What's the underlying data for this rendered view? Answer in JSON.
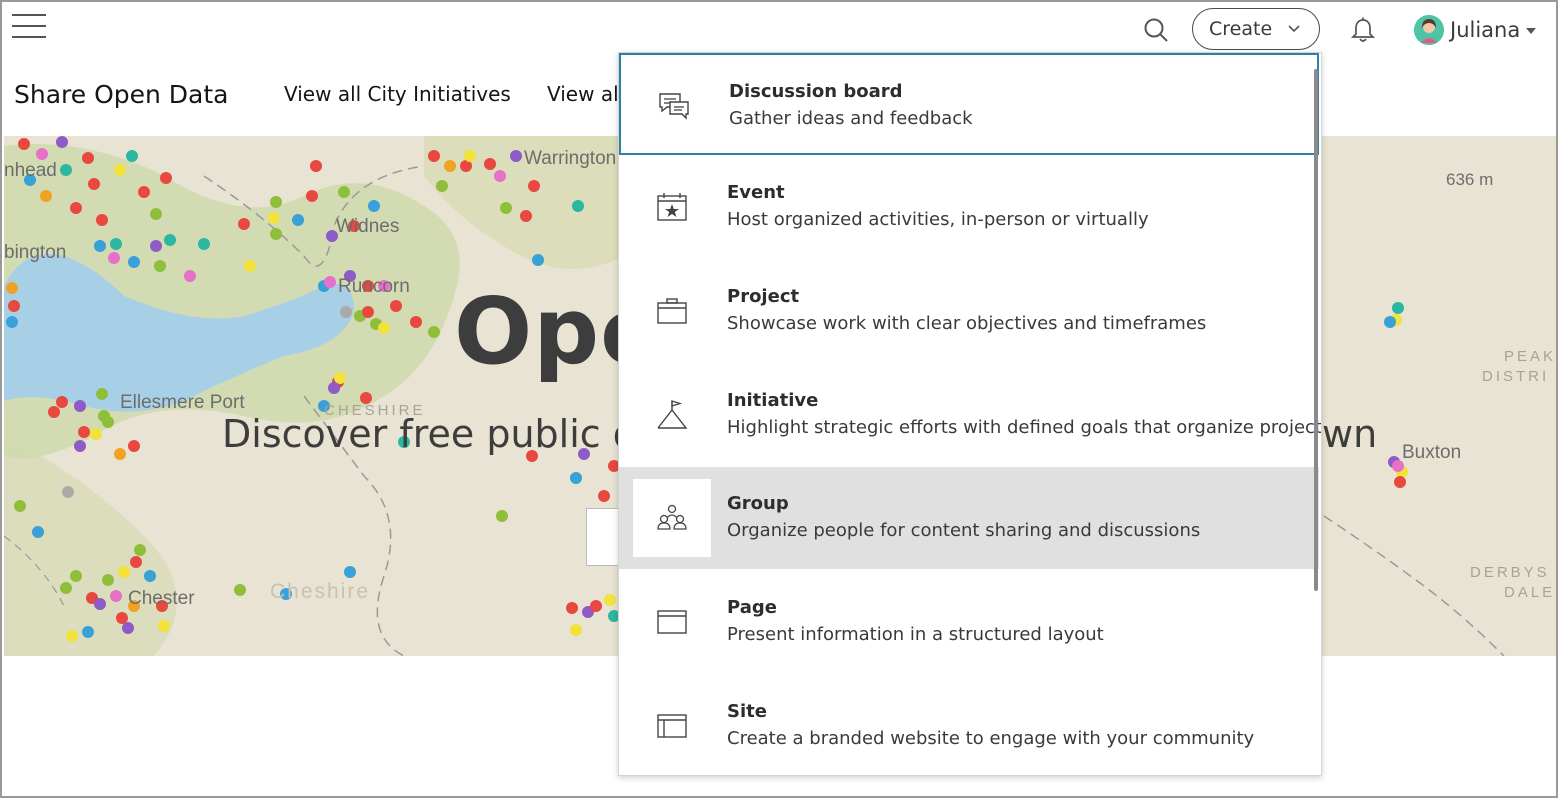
{
  "header": {
    "create_label": "Create",
    "user_name": "Juliana"
  },
  "nav": {
    "site_title": "Share Open Data",
    "links": [
      "View all City Initiatives",
      "View all"
    ]
  },
  "hero": {
    "title": "Ope",
    "subtitle": "Discover free public d",
    "subtitle_end": "wn",
    "map_labels": [
      "nhead",
      "Warrington",
      "bington",
      "Widnes",
      "Runcorn",
      "Ellesmere Port",
      "CHESHIRE",
      "Chester",
      "Cheshire",
      "636 m",
      "PEAK",
      "DISTRI",
      "Buxton",
      "DERBYS",
      "DALE"
    ]
  },
  "create_menu": {
    "items": [
      {
        "label": "Discussion board",
        "description": "Gather ideas and feedback",
        "icon": "discussion-icon"
      },
      {
        "label": "Event",
        "description": "Host organized activities, in-person or virtually",
        "icon": "event-calendar-icon"
      },
      {
        "label": "Project",
        "description": "Showcase work with clear objectives and timeframes",
        "icon": "briefcase-icon"
      },
      {
        "label": "Initiative",
        "description": "Highlight strategic efforts with defined goals that organize projects",
        "icon": "flag-mountain-icon"
      },
      {
        "label": "Group",
        "description": "Organize people for content sharing and discussions",
        "icon": "group-people-icon"
      },
      {
        "label": "Page",
        "description": "Present information in a structured layout",
        "icon": "page-layout-icon"
      },
      {
        "label": "Site",
        "description": "Create a branded website to engage with your community",
        "icon": "site-layout-icon"
      }
    ]
  },
  "colors": {
    "focus_border": "#2f7fa6",
    "hover_bg": "#e0e0e0",
    "map_bg": "#e8e3d2",
    "water": "#a7d0e6"
  }
}
